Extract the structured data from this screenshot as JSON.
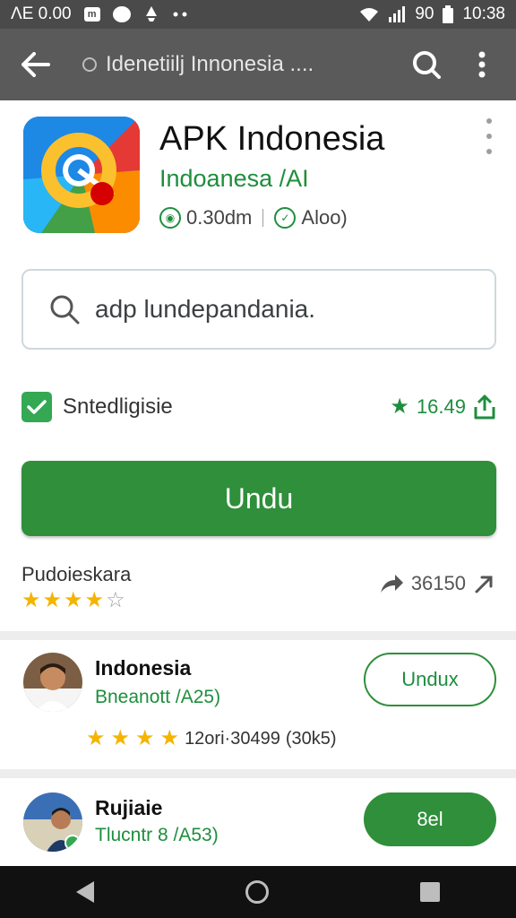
{
  "status_bar": {
    "left_text": "ΛE 0.00",
    "time": "10:38",
    "battery": "90",
    "icons": [
      "m-icon",
      "chat-bubble-icon",
      "notification-icon",
      "more-icon"
    ],
    "right_icons": [
      "wifi-icon",
      "signal-icon",
      "battery-icon"
    ]
  },
  "app_bar": {
    "title": "Idenetiilj Innonesia ....",
    "back_icon": "arrow-left-icon",
    "search_icon": "search-icon",
    "menu_icon": "more-vert-icon"
  },
  "app": {
    "name": "APK Indonesia",
    "developer": "Indoanesa /AI",
    "size": "0.30dm",
    "tag": "Aloo)"
  },
  "search": {
    "query": "adp lundepandania."
  },
  "option": {
    "label": "Sntedligisie",
    "checked": true,
    "rating_value": "16.49"
  },
  "install": {
    "label": "Undu"
  },
  "rating": {
    "label": "Pudoieskara",
    "stars": 4,
    "count": "36150"
  },
  "list": [
    {
      "title": "Indonesia",
      "subtitle": "Bneanott /A25)",
      "button": "Undux",
      "stars": 4,
      "rating_text": "12ori·30499",
      "rating_extra": "(30k5)"
    },
    {
      "title": "Rujiaie",
      "subtitle": "Tlucntr 8 /A53)",
      "button": "8el"
    }
  ],
  "colors": {
    "accent_green": "#2f8f3a",
    "text_green": "#1e8e3e",
    "star_yellow": "#f4b400",
    "app_bar": "#5a5a5a"
  }
}
